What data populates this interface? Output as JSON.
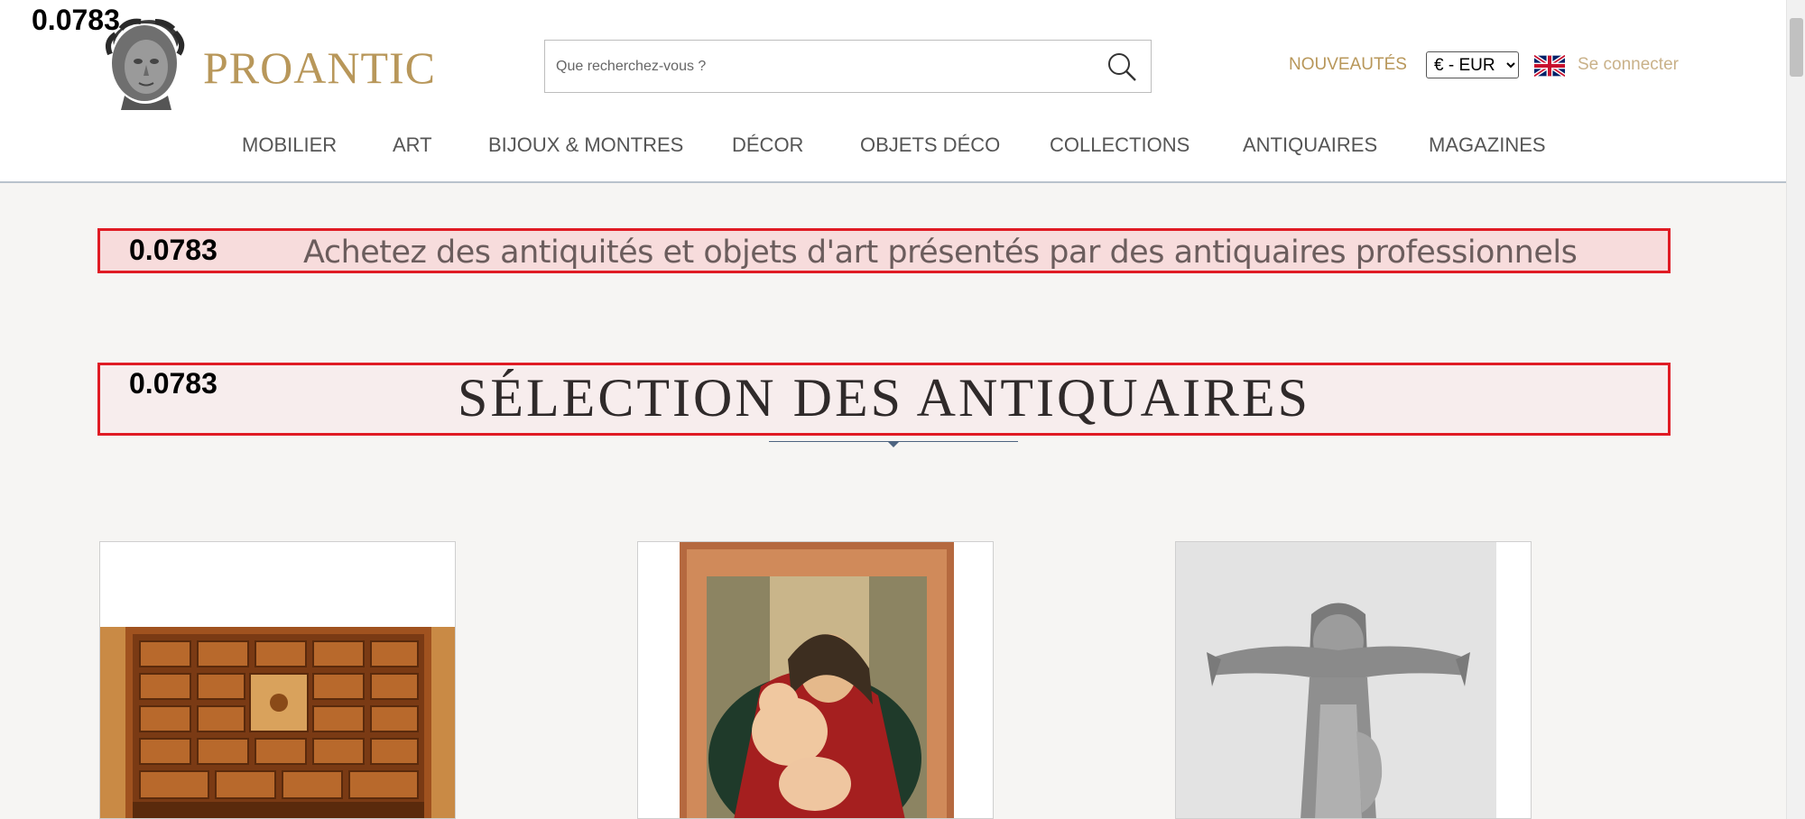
{
  "overlay": {
    "score": "0.0783"
  },
  "header": {
    "logo_text": "PROANTIC",
    "search": {
      "placeholder": "Que recherchez-vous ?",
      "value": ""
    },
    "new_arrivals": "NOUVEAUTÉS",
    "currency": {
      "selected": "€ - EUR"
    },
    "login": "Se connecter",
    "nav": [
      "MOBILIER",
      "ART",
      "BIJOUX & MONTRES",
      "DÉCOR",
      "OBJETS DÉCO",
      "COLLECTIONS",
      "ANTIQUAIRES",
      "MAGAZINES"
    ]
  },
  "main": {
    "tagline": "Achetez des antiquités et objets d'art présentés par des antiquaires professionnels",
    "section_title": "SÉLECTION DES ANTIQUAIRES",
    "products": [
      {
        "image": "cabinet-image"
      },
      {
        "image": "madonna-painting-image"
      },
      {
        "image": "silver-statue-image"
      }
    ]
  },
  "colors": {
    "gold": "#b8975a",
    "highlight_border": "#e01b24",
    "nav_text": "#555555"
  }
}
